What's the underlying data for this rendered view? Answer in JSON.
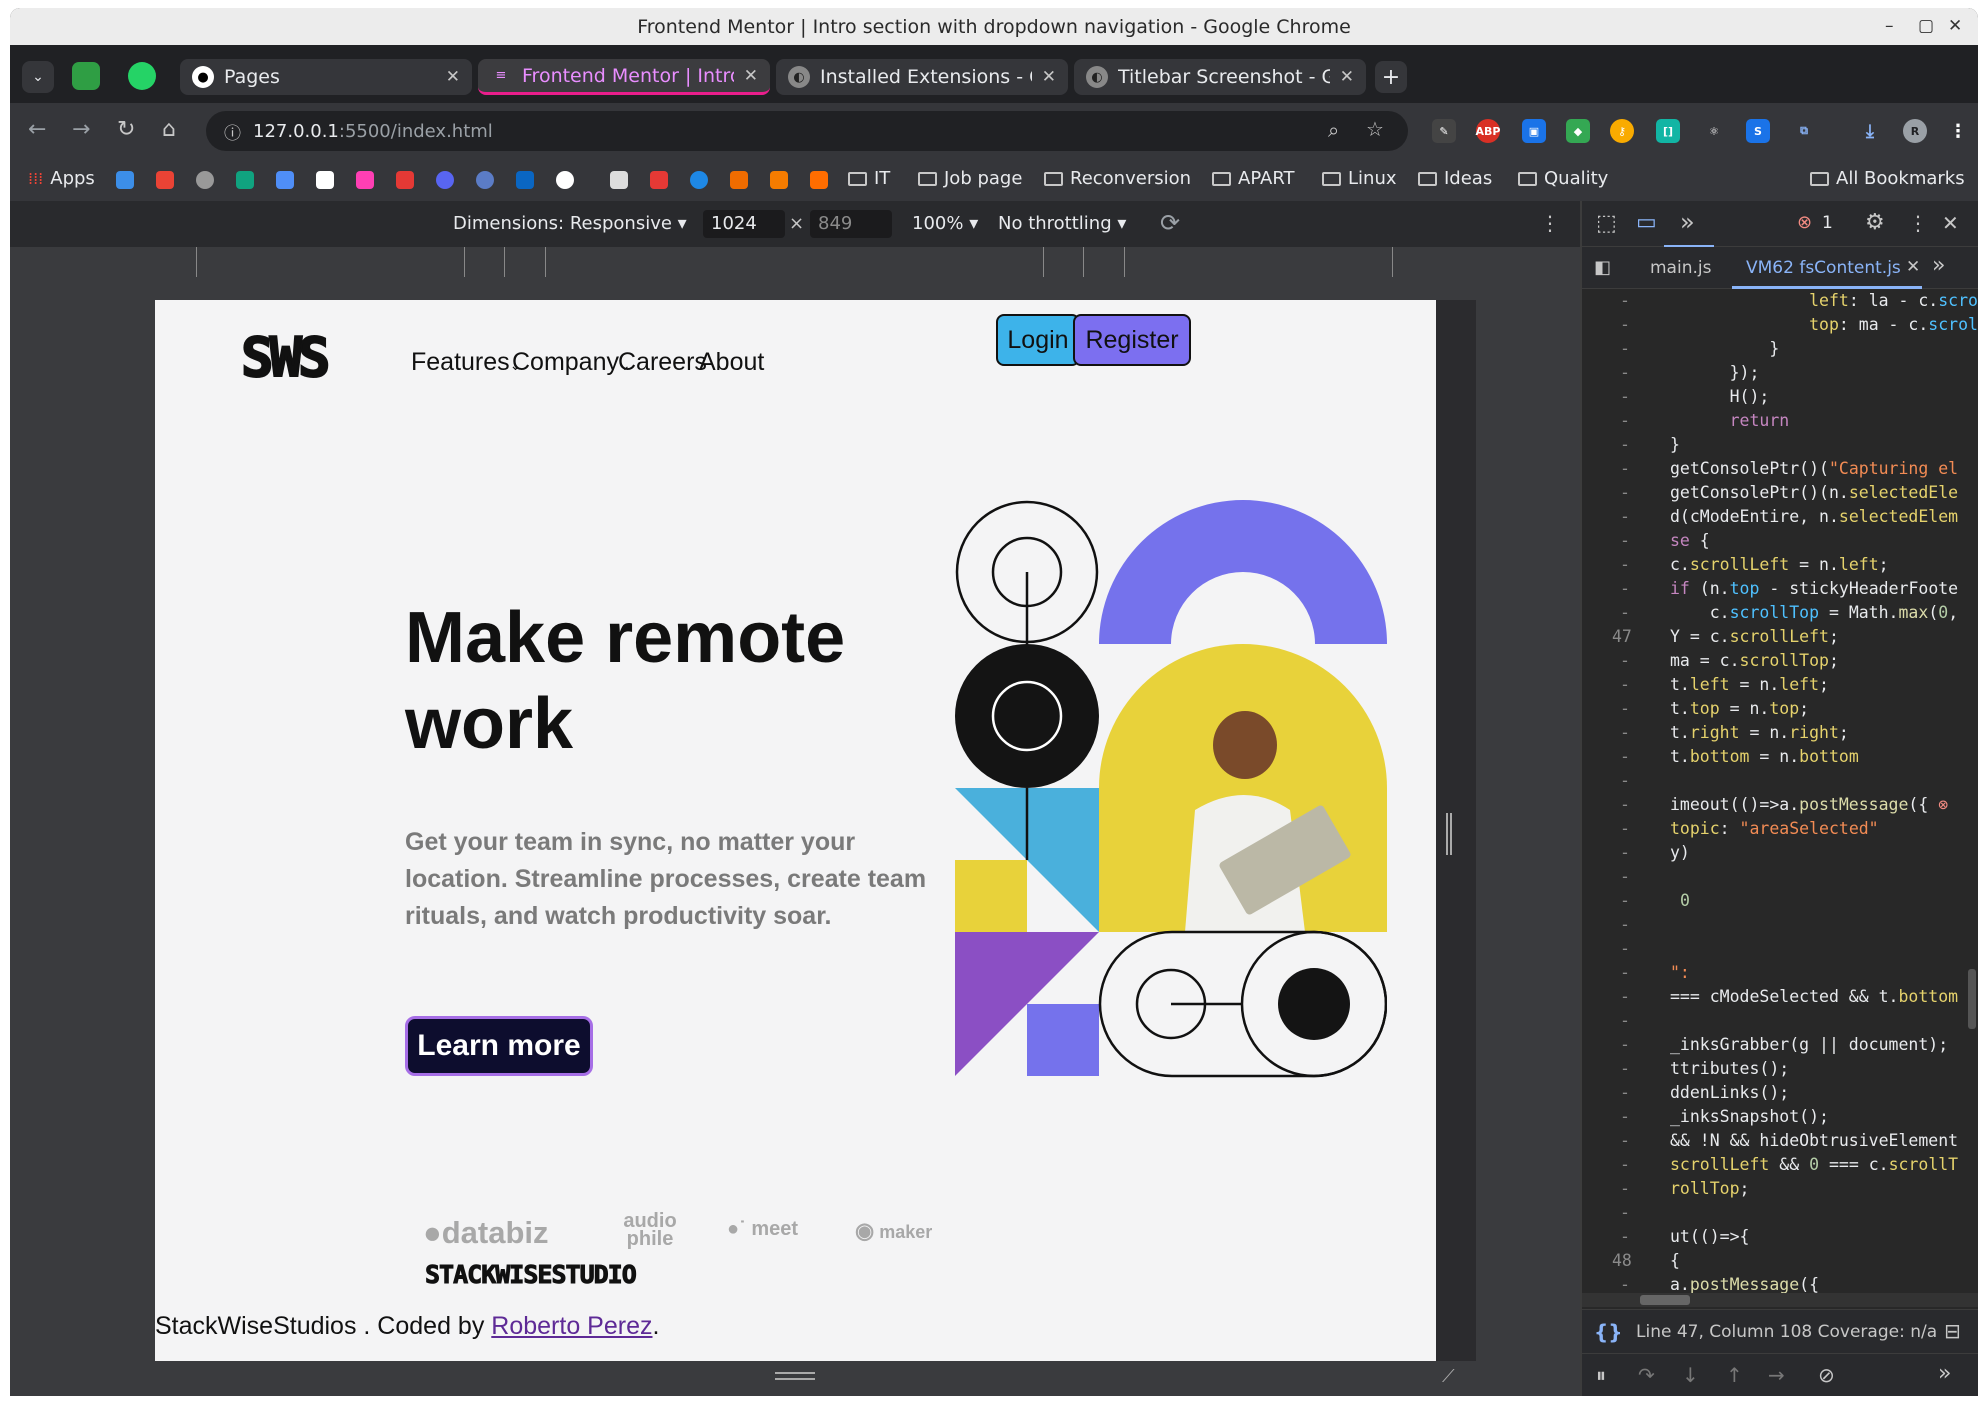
{
  "window": {
    "title": "Frontend Mentor | Intro section with dropdown navigation - Google Chrome",
    "controls": [
      "–",
      "▢",
      "✕"
    ]
  },
  "tabs": [
    {
      "label": "Pages",
      "icon": "github-icon"
    },
    {
      "label": "Frontend Mentor | Intro s",
      "icon": "frontend-mentor-icon",
      "active": true
    },
    {
      "label": "Installed Extensions - GN",
      "icon": "gnome-icon"
    },
    {
      "label": "Titlebar Screenshot - GN",
      "icon": "gnome-icon"
    }
  ],
  "address": {
    "host": "127.0.0.1",
    "path": ":5500/index.html"
  },
  "bookmarks": {
    "apps": "Apps",
    "folders": [
      "IT",
      "Job page",
      "Reconversion",
      "APART",
      "Linux",
      "Ideas",
      "Quality"
    ],
    "all": "All Bookmarks"
  },
  "device_toolbar": {
    "dimensions": "Dimensions: Responsive",
    "width": "1024",
    "times": "×",
    "height": "849",
    "zoom": "100%",
    "throttling": "No throttling"
  },
  "site": {
    "logo": "SWS",
    "nav": [
      "Features",
      "Company",
      "Careers",
      "About"
    ],
    "login": "Login",
    "register": "Register",
    "hero_title": "Make remote work",
    "hero_text": "Get your team in sync, no matter your location. Streamline processes, create team rituals, and watch productivity soar.",
    "cta": "Learn more",
    "clients": [
      "databiz",
      "audio phile",
      "meet",
      "maker"
    ],
    "studio_logo": "STACKWISESTUDIO",
    "footer_text": "StackWiseStudios . Coded by ",
    "footer_link": "Roberto Perez",
    "footer_end": ".",
    "colors": {
      "accent_purple": "#7572ec",
      "yellow": "#e8d23a",
      "cyan": "#4ab0dc",
      "violet": "#8b4fc4",
      "login_bg": "#3db3ea",
      "register_bg": "#7c6ff0"
    }
  },
  "devtools": {
    "error_count": "1",
    "file_tabs": [
      "main.js",
      "VM62 fsContent.js"
    ],
    "status": "Line 47, Column 108  Coverage: n/a"
  }
}
